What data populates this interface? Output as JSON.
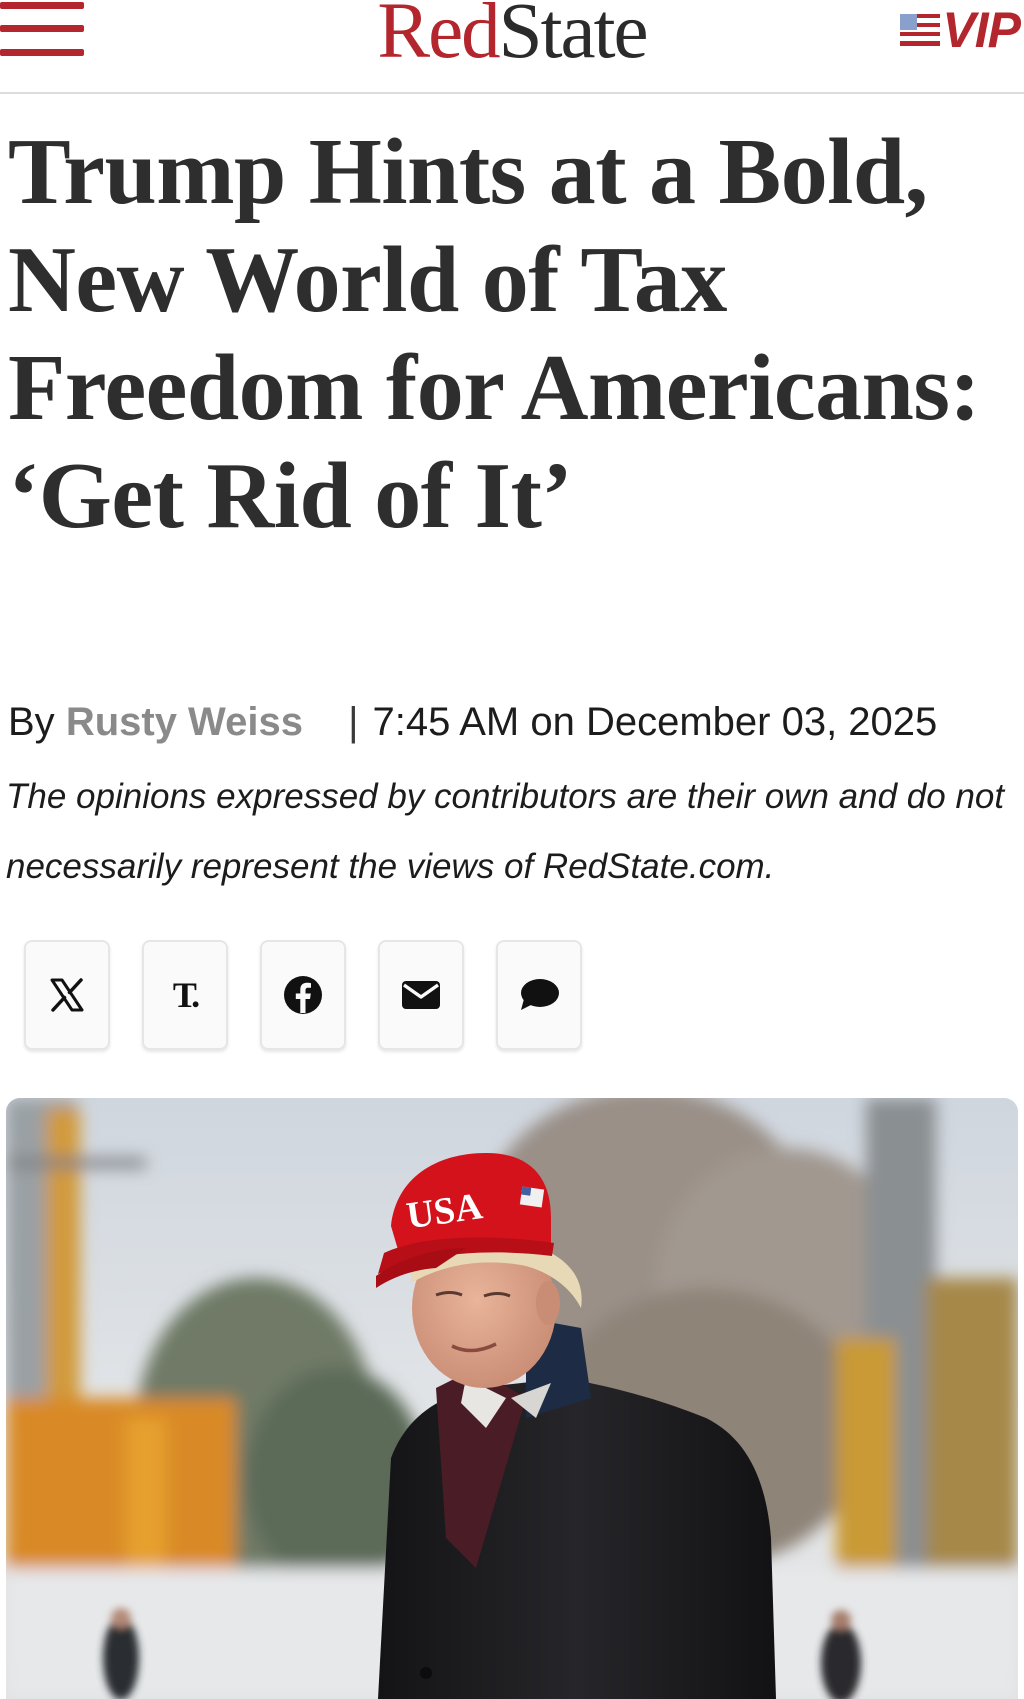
{
  "header": {
    "menu_icon": "hamburger-menu-icon",
    "logo": {
      "part1": "Red",
      "part2": "State"
    },
    "vip": {
      "label": "VIP",
      "flag_icon": "us-flag-icon"
    },
    "colors": {
      "brand_red": "#b3262d",
      "text_dark": "#2e2e2e"
    }
  },
  "article": {
    "headline": "Trump Hints at a Bold, New World of Tax Freedom for Americans: ‘Get Rid of It’",
    "byline": {
      "prefix": "By",
      "author": "Rusty Weiss",
      "separator": "|",
      "datetime": "7:45 AM on December 03, 2025"
    },
    "disclaimer": "The opinions expressed by contributors are their own and do not necessarily represent the views of RedState.com."
  },
  "share": {
    "buttons": [
      {
        "icon": "x-twitter-icon"
      },
      {
        "icon": "truth-social-icon",
        "glyph": "T."
      },
      {
        "icon": "facebook-icon"
      },
      {
        "icon": "email-icon"
      },
      {
        "icon": "comment-icon"
      }
    ]
  },
  "hero": {
    "cap_text": "USA",
    "colors": {
      "cap_red": "#d4121c",
      "coat": "#1b1b1d"
    }
  }
}
